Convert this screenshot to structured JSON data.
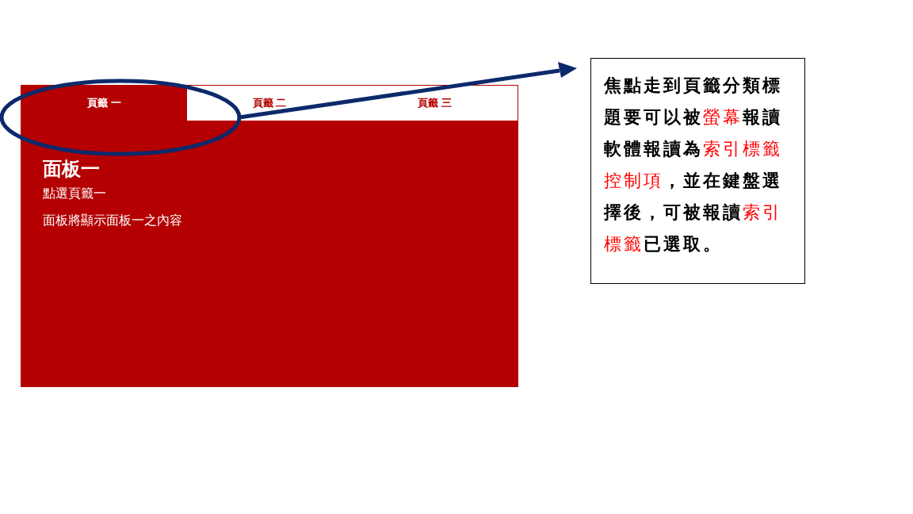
{
  "tabs": [
    {
      "label": "頁籤 一",
      "selected": true
    },
    {
      "label": "頁籤 二",
      "selected": false
    },
    {
      "label": "頁籤 三",
      "selected": false
    }
  ],
  "panel": {
    "title": "面板一",
    "lines": [
      "點選頁籤一",
      "面板將顯示面板一之內容"
    ]
  },
  "callout": {
    "segments": [
      {
        "text": "焦點走到頁籤分類標題要可以被",
        "highlight": false
      },
      {
        "text": "螢幕",
        "highlight": true
      },
      {
        "text": "報讀軟體報讀為",
        "highlight": false
      },
      {
        "text": "索引標籤控制項",
        "highlight": true
      },
      {
        "text": "，並在鍵盤選擇後，可被報讀",
        "highlight": false
      },
      {
        "text": "索引標籤",
        "highlight": true
      },
      {
        "text": "已選取。",
        "highlight": false
      }
    ]
  }
}
